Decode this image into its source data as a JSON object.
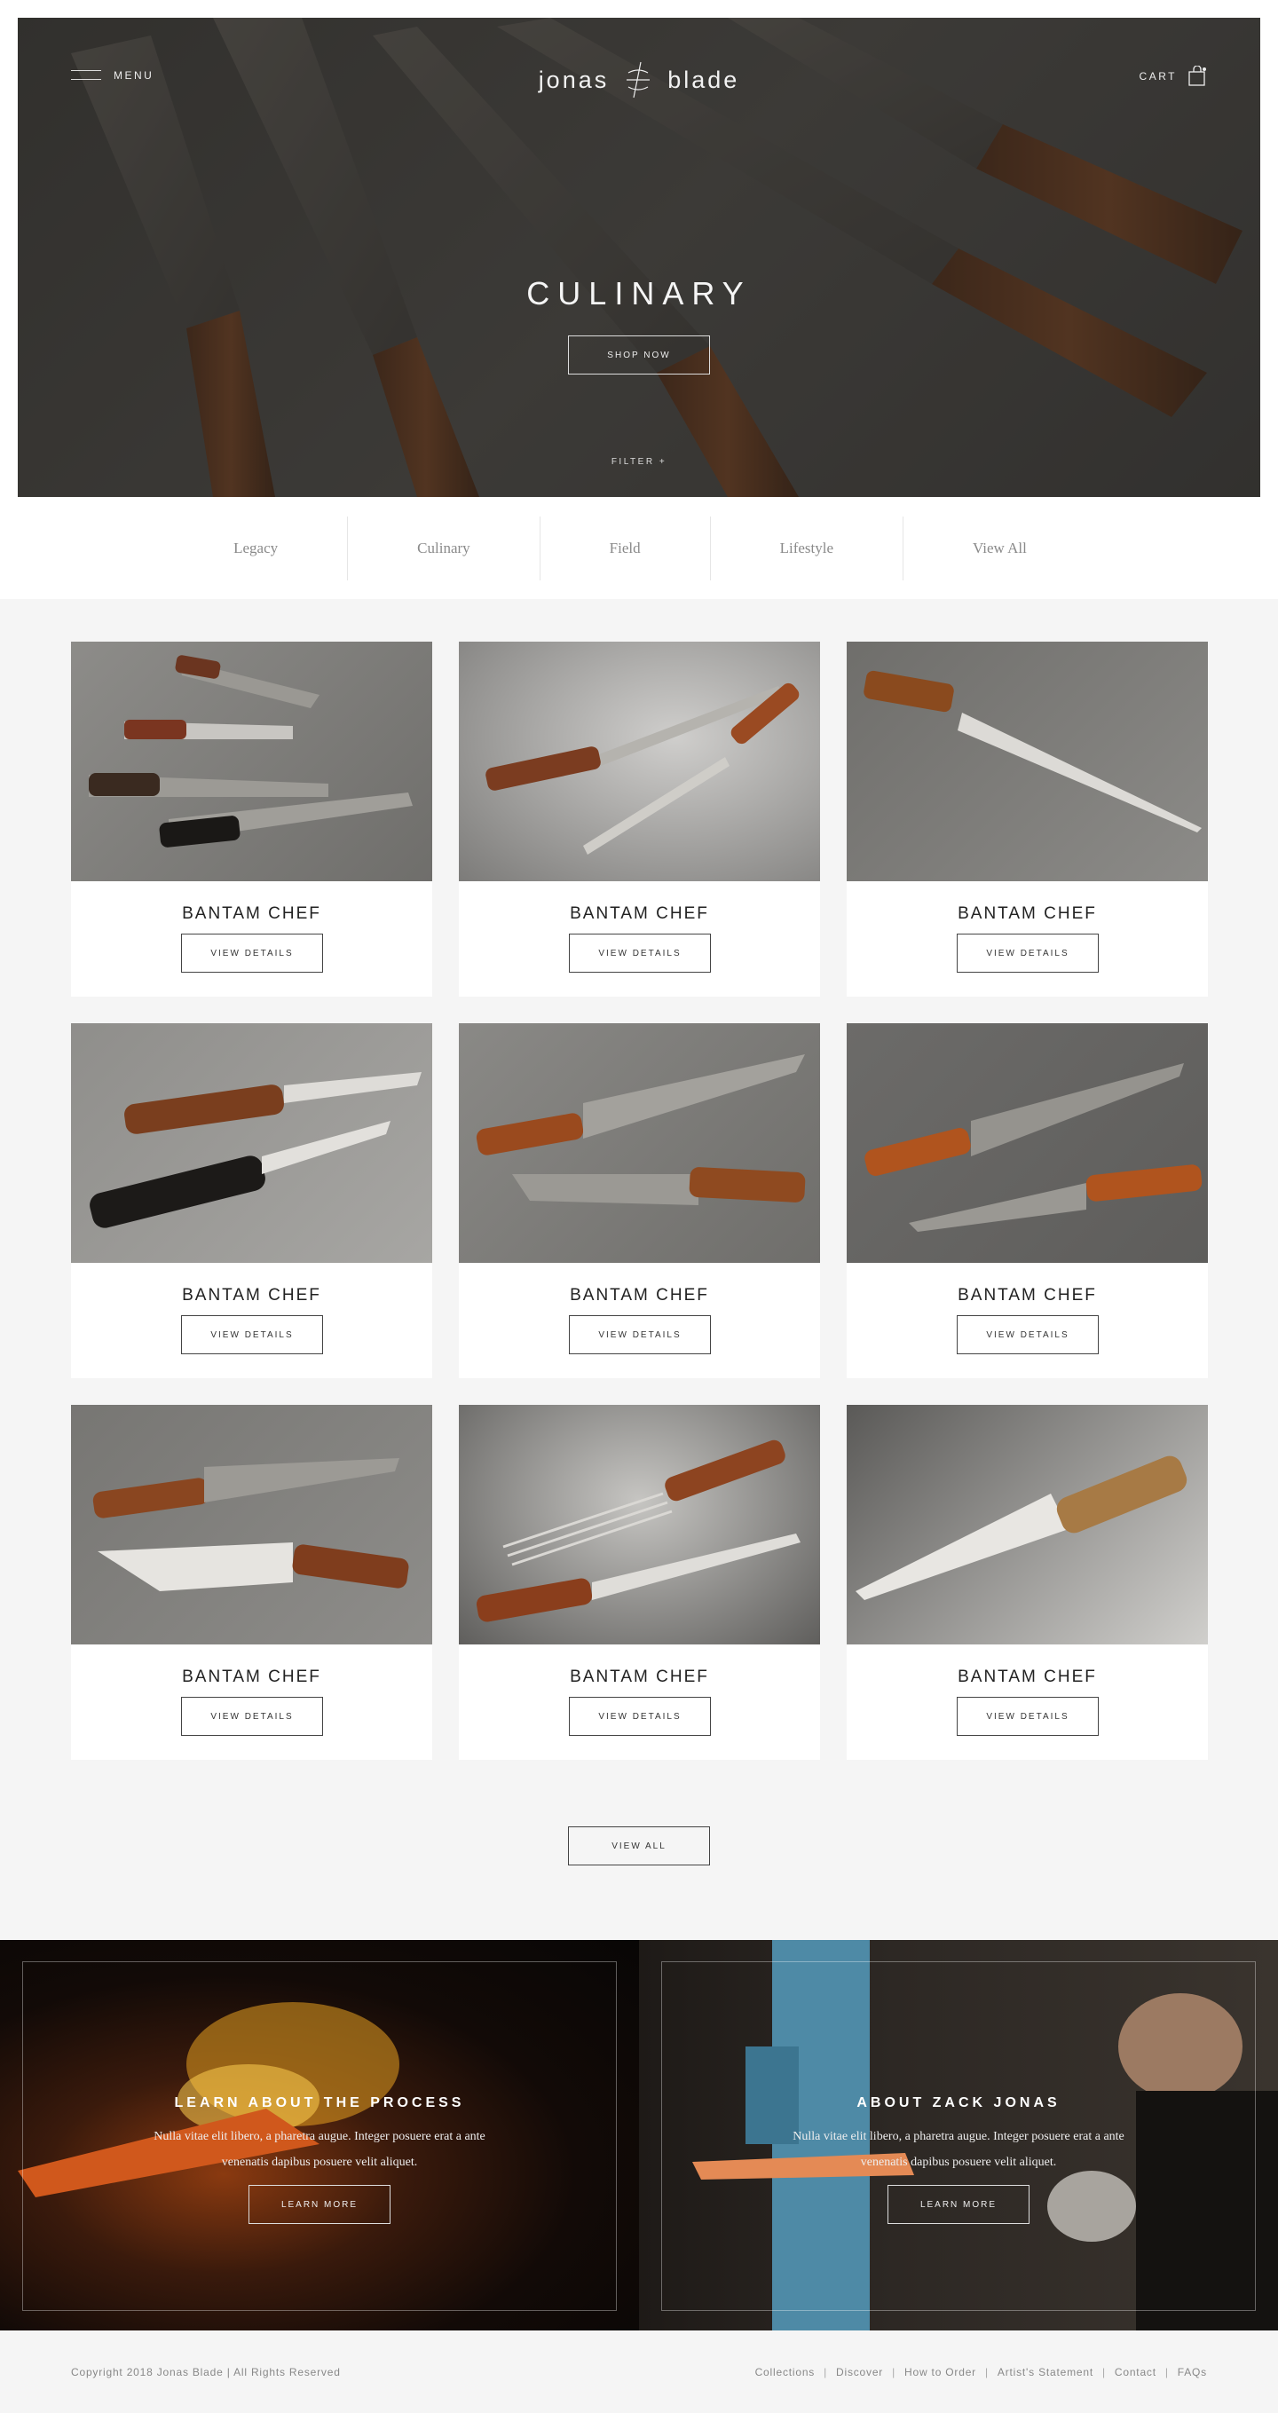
{
  "header": {
    "menu_label": "MENU",
    "logo_left": "jonas",
    "logo_right": "blade",
    "cart_label": "CART"
  },
  "hero": {
    "title": "CULINARY",
    "button_label": "SHOP NOW",
    "filter_label": "FILTER +"
  },
  "categories": [
    "Legacy",
    "Culinary",
    "Field",
    "Lifestyle",
    "View All"
  ],
  "products": [
    {
      "name": "BANTAM CHEF",
      "button": "VIEW DETAILS"
    },
    {
      "name": "BANTAM CHEF",
      "button": "VIEW DETAILS"
    },
    {
      "name": "BANTAM CHEF",
      "button": "VIEW DETAILS"
    },
    {
      "name": "BANTAM CHEF",
      "button": "VIEW DETAILS"
    },
    {
      "name": "BANTAM CHEF",
      "button": "VIEW DETAILS"
    },
    {
      "name": "BANTAM CHEF",
      "button": "VIEW DETAILS"
    },
    {
      "name": "BANTAM CHEF",
      "button": "VIEW DETAILS"
    },
    {
      "name": "BANTAM CHEF",
      "button": "VIEW DETAILS"
    },
    {
      "name": "BANTAM CHEF",
      "button": "VIEW DETAILS"
    }
  ],
  "view_all_label": "VIEW ALL",
  "promos": [
    {
      "title": "LEARN ABOUT THE PROCESS",
      "text": "Nulla vitae elit libero, a pharetra augue. Integer posuere erat a ante venenatis dapibus posuere velit aliquet.",
      "button": "LEARN MORE"
    },
    {
      "title": "ABOUT ZACK JONAS",
      "text": "Nulla vitae elit libero, a pharetra augue. Integer posuere erat a ante venenatis dapibus posuere velit aliquet.",
      "button": "LEARN MORE"
    }
  ],
  "footer": {
    "copyright": "Copyright 2018 Jonas Blade | All Rights Reserved",
    "links": [
      "Collections",
      "Discover",
      "How to Order",
      "Artist's Statement",
      "Contact",
      "FAQs"
    ]
  }
}
